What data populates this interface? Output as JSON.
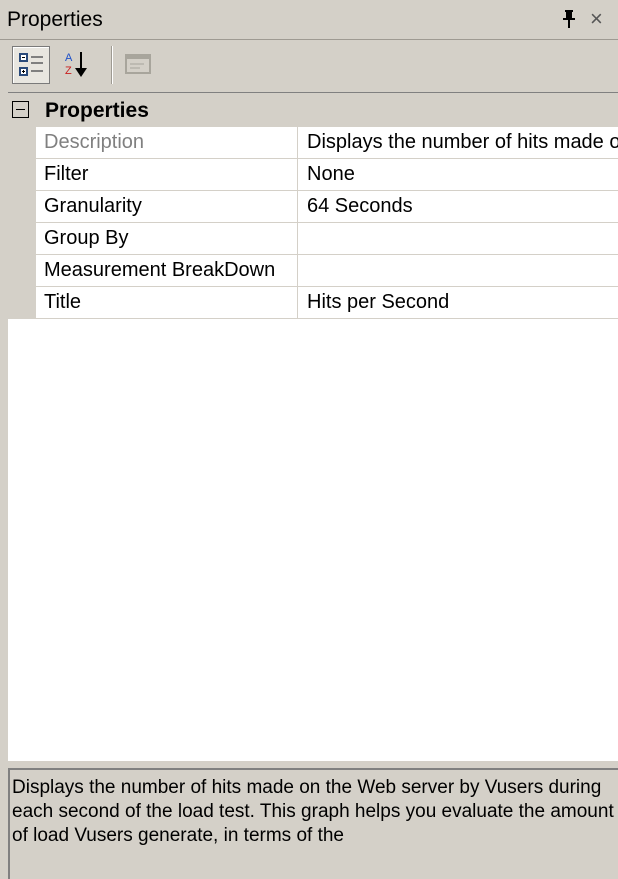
{
  "window": {
    "title": "Properties",
    "pin_icon": "pin-icon",
    "close_icon": "close-icon"
  },
  "toolbar": {
    "buttons": [
      {
        "name": "categorized-view",
        "icon": "categorized-icon",
        "pressed": true
      },
      {
        "name": "alphabetical-sort",
        "icon": "sort-az-icon",
        "pressed": false
      },
      {
        "name": "property-pages",
        "icon": "property-pages-icon",
        "enabled": false
      }
    ]
  },
  "grid": {
    "category": {
      "label": "Properties",
      "expanded": true
    },
    "rows": [
      {
        "name": "Description",
        "value": "Displays the number of hits made on the Web server by Vusers",
        "readonly": true
      },
      {
        "name": "Filter",
        "value": "None",
        "readonly": false
      },
      {
        "name": "Granularity",
        "value": "64 Seconds",
        "readonly": false
      },
      {
        "name": "Group By",
        "value": "",
        "readonly": false
      },
      {
        "name": "Measurement BreakDown",
        "value": "",
        "readonly": false
      },
      {
        "name": "Title",
        "value": "Hits per Second",
        "readonly": false
      }
    ]
  },
  "description": {
    "text": "Displays the number of hits made on the Web server by Vusers during each second of the load test. This graph helps you evaluate the amount of load Vusers generate, in terms of the"
  }
}
